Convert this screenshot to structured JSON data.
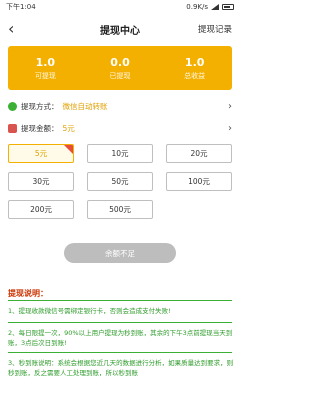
{
  "status": {
    "time": "下午1:04",
    "speed": "0.9K/s"
  },
  "nav": {
    "back_glyph": "‹",
    "title": "提现中心",
    "right_label": "提现记录"
  },
  "stats": [
    {
      "value": "1.0",
      "label": "可提现"
    },
    {
      "value": "0.0",
      "label": "已提现"
    },
    {
      "value": "1.0",
      "label": "总收益"
    }
  ],
  "method": {
    "label": "提现方式：",
    "value": "微信自动转账",
    "value_color": "#e0a000"
  },
  "amount": {
    "label": "提现金额：",
    "value": "5元",
    "value_color": "#e0a000"
  },
  "amounts": [
    "5元",
    "10元",
    "20元",
    "30元",
    "50元",
    "100元",
    "200元",
    "500元"
  ],
  "selected_amount": "5元",
  "submit_label": "余额不足",
  "notes": {
    "title": "提现说明：",
    "items": [
      "1、提现收款微信号需绑定银行卡，否则会造成支付失败!",
      "2、每日限提一次，90%以上用户提现为秒到账，其余的下午3点前提现当天到账，3点后次日到账!",
      "3、秒到账说明：系统会根据您近几天的数据进行分析，如果质量达到要求，则秒到账，反之需要人工处理到账，所以秒到账"
    ]
  },
  "colors": {
    "brand": "#f4b000",
    "note_green": "#2e9c2b",
    "disabled": "#bdbdbd"
  }
}
